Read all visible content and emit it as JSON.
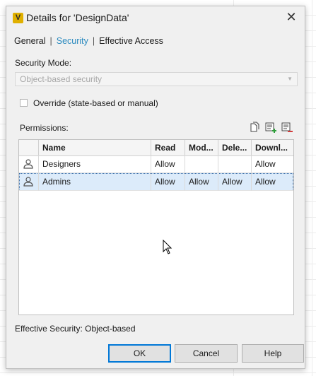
{
  "dialog": {
    "title": "Details for 'DesignData'",
    "app_icon_letter": "V",
    "close_glyph": "✕"
  },
  "tabs": [
    {
      "label": "General"
    },
    {
      "label": "Security",
      "active": true
    },
    {
      "label": "Effective Access"
    }
  ],
  "tab_separator": "|",
  "security_mode": {
    "label": "Security Mode:",
    "value": "Object-based security"
  },
  "override": {
    "label": "Override (state-based or manual)",
    "checked": false
  },
  "permissions": {
    "label": "Permissions:",
    "toolbar_icons": [
      "copy-icon",
      "add-permission-icon",
      "remove-permission-icon"
    ],
    "columns": [
      "Name",
      "Read",
      "Mod...",
      "Dele...",
      "Downl..."
    ],
    "rows": [
      {
        "name": "Designers",
        "read": "Allow",
        "modify": "",
        "delete": "",
        "download": "Allow",
        "icon": "user-icon"
      },
      {
        "name": "Admins",
        "read": "Allow",
        "modify": "Allow",
        "delete": "Allow",
        "download": "Allow",
        "icon": "user-icon",
        "selected": true
      }
    ]
  },
  "effective_security": "Effective Security: Object-based",
  "buttons": {
    "ok": "OK",
    "cancel": "Cancel",
    "help": "Help"
  },
  "colors": {
    "accent": "#0078d7",
    "active_tab": "#2a8abf",
    "selection": "#dcebfa",
    "icon_yellow": "#e0b000",
    "add_green": "#2e9e3a",
    "remove_red": "#d23b3b"
  }
}
